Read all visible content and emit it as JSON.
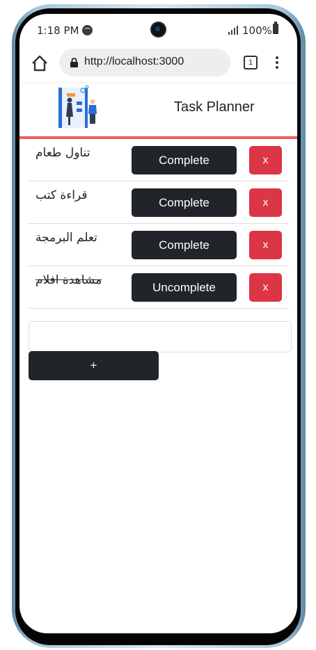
{
  "status_bar": {
    "time": "1:18 PM",
    "battery": "100%"
  },
  "browser": {
    "url": "http://localhost:3000",
    "tab_count": "1"
  },
  "app": {
    "title": "Task Planner"
  },
  "tasks": [
    {
      "text": "تناول طعام",
      "button": "Complete",
      "delete": "x",
      "completed": false
    },
    {
      "text": "قراءة كتب",
      "button": "Complete",
      "delete": "x",
      "completed": false
    },
    {
      "text": "تعلم البرمجة",
      "button": "Complete",
      "delete": "x",
      "completed": false
    },
    {
      "text": "مشاهدة افلام",
      "button": "Uncomplete",
      "delete": "x",
      "completed": true
    }
  ],
  "form": {
    "input_value": "",
    "add_label": "+"
  },
  "colors": {
    "accent_line": "#f35a5a",
    "dark_button": "#212529",
    "danger_button": "#dc3545"
  }
}
